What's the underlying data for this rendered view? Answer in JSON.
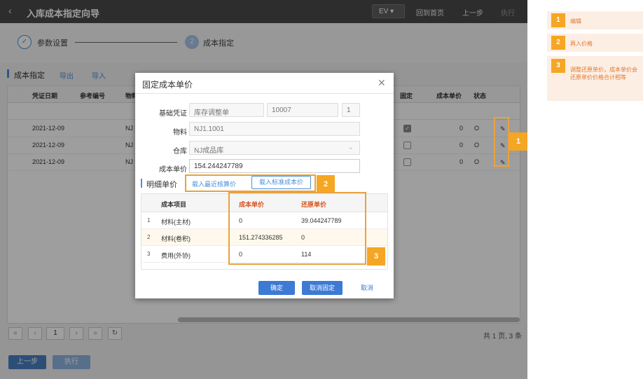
{
  "topbar": {
    "back_icon": "chevron-left-icon",
    "title": "入库成本指定向导",
    "ev_label": "EV",
    "home": "回到首页",
    "prev": "上一步",
    "exec": "执行"
  },
  "steps": {
    "step1_label": "参数设置",
    "step2_number": "2",
    "step2_label": "成本指定"
  },
  "toolbar": {
    "title": "成本指定",
    "export": "导出",
    "import": "导入"
  },
  "grid": {
    "columns": [
      "凭证日期",
      "参考编号",
      "物料",
      "固定",
      "成本单价",
      "状态"
    ],
    "rows": [
      {
        "date": "2021-12-09",
        "mat": "NJ",
        "fixed": true,
        "price": "0",
        "status": "O"
      },
      {
        "date": "2021-12-09",
        "mat": "NJ",
        "fixed": false,
        "price": "0",
        "status": "O"
      },
      {
        "date": "2021-12-09",
        "mat": "NJ",
        "fixed": false,
        "price": "0",
        "status": "O"
      }
    ]
  },
  "pager": {
    "first": "«",
    "prev": "‹",
    "page": "1",
    "next": "›",
    "last": "»",
    "refresh_icon": "refresh-icon",
    "info": "共 1 页, 3 条"
  },
  "bottom": {
    "prev": "上一步",
    "exec": "执行"
  },
  "dialog": {
    "title": "固定成本单价",
    "close_icon": "close-icon",
    "basis_label": "基础凭证",
    "basis_value": "库存调整单",
    "basis_no": "10007",
    "basis_line": "1",
    "material_label": "物料",
    "material_value": "NJ1.1001",
    "warehouse_label": "仓库",
    "warehouse_value": "NJ成品库",
    "unit_cost_label": "成本单价",
    "unit_cost_value": "154.244247789",
    "detail_title": "明细单价",
    "load_recent": "载入最近核算价",
    "load_standard": "载入标准成本价",
    "table": {
      "headers": [
        "成本项目",
        "成本单价",
        "还原单价"
      ],
      "rows": [
        {
          "idx": "1",
          "item": "材料(主材)",
          "cost": "0",
          "restore": "39.044247789"
        },
        {
          "idx": "2",
          "item": "材料(卷积)",
          "cost": "151.274336285",
          "restore": "0"
        },
        {
          "idx": "3",
          "item": "费用(外协)",
          "cost": "0",
          "restore": "114"
        }
      ]
    },
    "ok": "确定",
    "unfix": "取消固定",
    "cancel": "取消"
  },
  "annotations": {
    "badge1": "1",
    "badge2": "2",
    "badge3": "3"
  },
  "legend": [
    {
      "num": "1",
      "text": "编辑"
    },
    {
      "num": "2",
      "text": "再入价格"
    },
    {
      "num": "3",
      "text": "调整还原单价，成本单价会还原单价价格合计相等"
    }
  ]
}
